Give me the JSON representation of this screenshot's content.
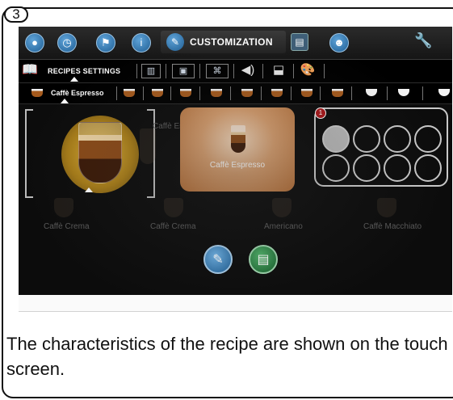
{
  "step": {
    "number": "3"
  },
  "topbar": {
    "title": "CUSTOMIZATION",
    "icons": [
      "water-drop-icon",
      "clock-icon",
      "flag-icon",
      "info-icon",
      "pencil-icon",
      "display-icon",
      "user-icon",
      "wrench-icon"
    ]
  },
  "toolbar2": {
    "label": "RECIPES SETTINGS",
    "icons": [
      "recipe-book-icon",
      "open-book-icon",
      "screen-icon",
      "framed-picture-icon",
      "speaker-icon",
      "milk-icon",
      "palette-icon"
    ]
  },
  "recipe_bar": {
    "selected_label": "Caffè Espresso",
    "icons": [
      "cup-icon",
      "cup-icon",
      "cup-icon",
      "cup-icon",
      "cup-icon",
      "cup-icon",
      "cup-icon",
      "cup-icon",
      "cup-icon",
      "cup-icon",
      "cup-icon",
      "cup-icon"
    ]
  },
  "main": {
    "selected_card_label": "Caffè Espresso",
    "cups_count": "1",
    "cups": {
      "total": 8,
      "filled": 1
    },
    "ghost_labels": [
      "Caffè Espresso",
      "Caffè Crema",
      "Caffè Crema",
      "Americano",
      "Caffè Macchiato"
    ]
  },
  "buttons": {
    "edit": "edit-icon",
    "save": "save-icon"
  },
  "caption": "The characteristics of the recipe are shown on the touch screen."
}
